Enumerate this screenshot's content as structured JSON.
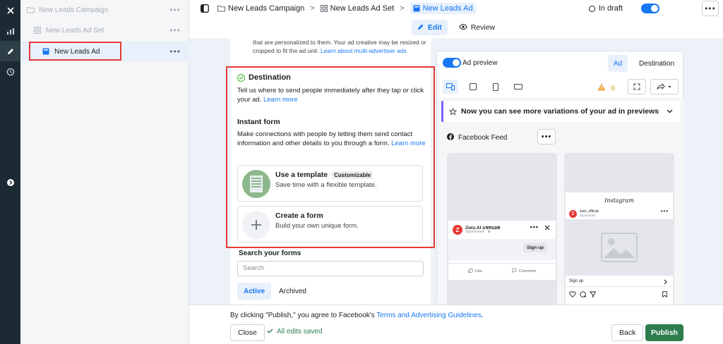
{
  "colors": {
    "accent": "#1877f2",
    "highlight": "#e53935",
    "publish": "#2e7d4f",
    "rail": "#1c2b33"
  },
  "rail": {
    "icons": [
      "close-icon",
      "chart-icon",
      "pencil-icon",
      "clock-icon",
      "expand-icon"
    ]
  },
  "tree": {
    "campaign": "New Leads Campaign",
    "adset": "New Leads Ad Set",
    "ad": "New Leads Ad",
    "more": "•••"
  },
  "breadcrumb": {
    "campaign": "New Leads Campaign",
    "adset": "New Leads Ad Set",
    "ad": "New Leads Ad",
    "sep": ">"
  },
  "status": {
    "draft": "In draft",
    "more": "•••"
  },
  "mode": {
    "edit": "Edit",
    "review": "Review"
  },
  "intro": {
    "text": "that are personalized to them. Your ad creative may be resized or cropped to fit the ad unit.",
    "link": "Learn about multi-advertiser ads"
  },
  "destination": {
    "title": "Destination",
    "desc": "Tell us where to send people immediately after they tap or click your ad.",
    "link": "Learn more"
  },
  "instant_form": {
    "title": "Instant form",
    "desc": "Make connections with people by letting them send contact information and other details to you through a form.",
    "link": "Learn more"
  },
  "template_option": {
    "title": "Use a template",
    "badge": "Customizable",
    "desc": "Save time with a flexible template."
  },
  "create_option": {
    "title": "Create a form",
    "desc": "Build your own unique form."
  },
  "search": {
    "label": "Search your forms",
    "placeholder": "Search"
  },
  "form_tabs": {
    "active": "Active",
    "archived": "Archived"
  },
  "preview": {
    "toggle_label": "Ad preview",
    "tab_ad": "Ad",
    "tab_destination": "Destination",
    "warning_count": "1",
    "banner": "Now you can see more variations of your ad in previews",
    "placement": "Facebook Feed",
    "more": "•••",
    "fb_mock": {
      "page": "Zwiz.AI แชทบอท",
      "sponsored": "Sponsored · ⊕",
      "cta": "Sign up",
      "like": "Like",
      "comment": "Comment"
    },
    "ig_mock": {
      "brand": "Instagram",
      "account": "zwiz_official",
      "sponsored": "Sponsored",
      "cta": "Sign up"
    }
  },
  "footer": {
    "consent_prefix": "By clicking \"Publish,\" you agree to Facebook's",
    "consent_link": "Terms and Advertising Guidelines",
    "consent_suffix": ".",
    "close": "Close",
    "saved": "All edits saved",
    "back": "Back",
    "publish": "Publish"
  }
}
